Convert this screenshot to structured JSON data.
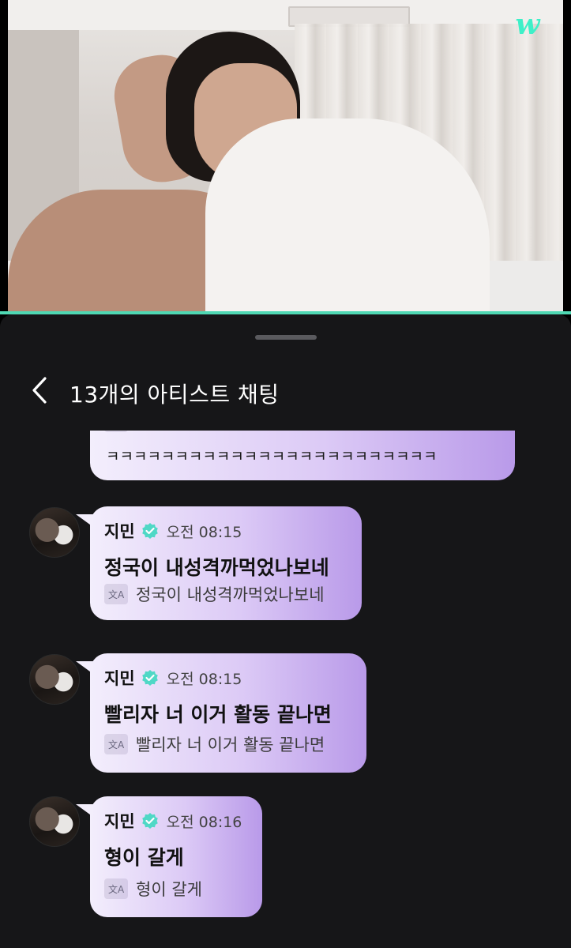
{
  "header": {
    "title": "13개의 아티스트 채팅"
  },
  "brand": {
    "logo_text": "w",
    "accent": "#4fd8b3",
    "logo_color": "#3ef0c8"
  },
  "messages": [
    {
      "text": "ㅋㅋㅋㅋㅋㅋㅋㅋㅋㅋㅋㅋㅋㅋㅋㅋㅋㅋㅋㅋㅋㅋㅋㅋ",
      "translation_icon": "translate-icon"
    },
    {
      "name": "지민",
      "time": "오전 08:15",
      "text": "정국이 내성격까먹었나보네",
      "translation": "정국이 내성격까먹었나보네"
    },
    {
      "name": "지민",
      "time": "오전 08:15",
      "text": "빨리자 너 이거 활동 끝나면",
      "translation": "빨리자 너 이거 활동 끝나면"
    },
    {
      "name": "지민",
      "time": "오전 08:16",
      "text": "형이 갈게",
      "translation": "형이 갈게"
    }
  ],
  "colors": {
    "bubble_start": "#f3eefc",
    "bubble_end": "#b99ae9",
    "verified": "#4fd8c6",
    "background": "#161618"
  }
}
